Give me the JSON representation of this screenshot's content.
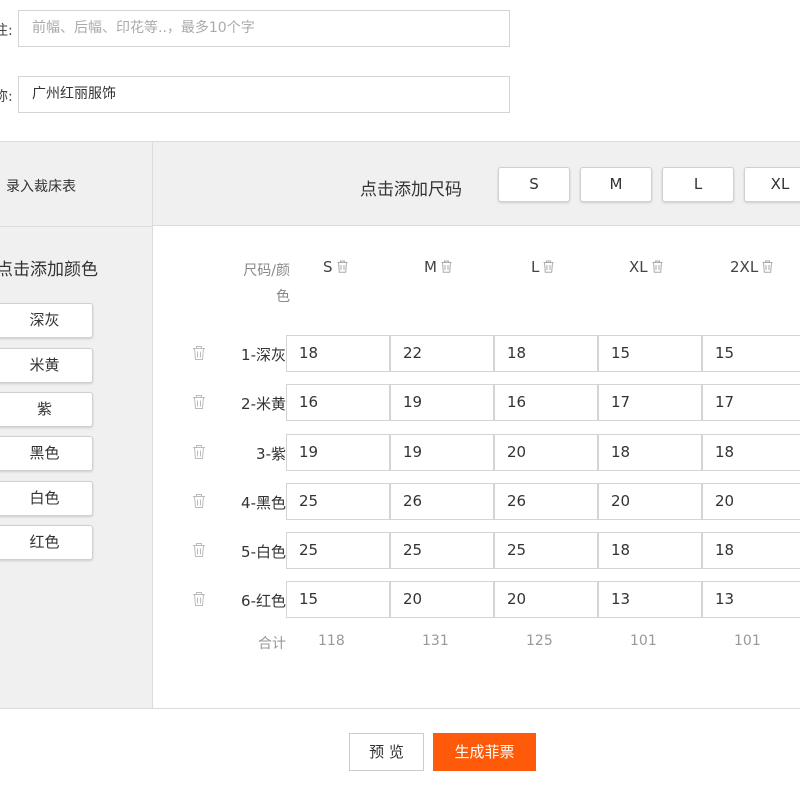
{
  "form": {
    "field1": {
      "label": "注:",
      "placeholder": "前幅、后幅、印花等..，最多10个字",
      "value": ""
    },
    "field2": {
      "label": "称:",
      "value": "广州红丽服饰"
    }
  },
  "cut_table_label": "录入裁床表",
  "add_size_label": "点击添加尺码",
  "size_buttons": [
    "S",
    "M",
    "L",
    "XL"
  ],
  "add_color_label": "点击添加颜色",
  "color_buttons": [
    "深灰",
    "米黄",
    "紫",
    "黑色",
    "白色",
    "红色"
  ],
  "table": {
    "corner_line1": "尺码/颜",
    "corner_line2": "色",
    "columns": [
      "S",
      "M",
      "L",
      "XL",
      "2XL"
    ],
    "rows": [
      {
        "label": "1-深灰",
        "values": [
          "18",
          "22",
          "18",
          "15",
          "15"
        ]
      },
      {
        "label": "2-米黄",
        "values": [
          "16",
          "19",
          "16",
          "17",
          "17"
        ]
      },
      {
        "label": "3-紫",
        "values": [
          "19",
          "19",
          "20",
          "18",
          "18"
        ]
      },
      {
        "label": "4-黑色",
        "values": [
          "25",
          "26",
          "26",
          "20",
          "20"
        ]
      },
      {
        "label": "5-白色",
        "values": [
          "25",
          "25",
          "25",
          "18",
          "18"
        ]
      },
      {
        "label": "6-红色",
        "values": [
          "15",
          "20",
          "20",
          "13",
          "13"
        ]
      }
    ],
    "total_label": "合计",
    "totals": [
      "118",
      "131",
      "125",
      "101",
      "101"
    ]
  },
  "actions": {
    "preview": "预 览",
    "generate": "生成菲票",
    "generate_color": "#ff5a09"
  },
  "icons": {
    "column_delete": "trash-icon",
    "row_delete": "trash-icon"
  }
}
